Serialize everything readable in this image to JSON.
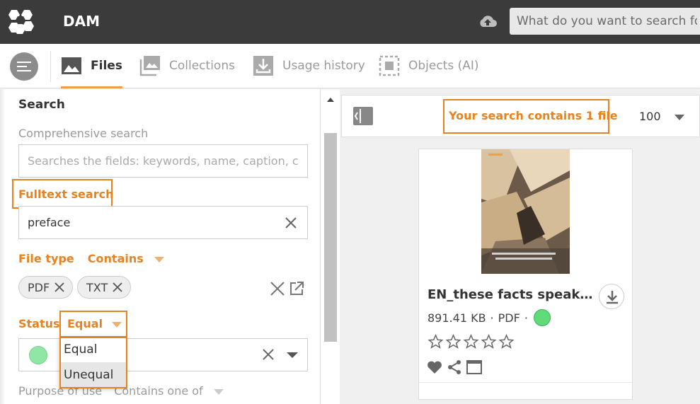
{
  "app": {
    "title": "DAM"
  },
  "header": {
    "search_placeholder": "What do you want to search for?"
  },
  "tabs": [
    {
      "label": "Files",
      "icon": "image-icon",
      "active": true
    },
    {
      "label": "Collections",
      "icon": "collections-icon",
      "active": false
    },
    {
      "label": "Usage history",
      "icon": "download-tray-icon",
      "active": false
    },
    {
      "label": "Objects (AI)",
      "icon": "object-detect-icon",
      "active": false
    }
  ],
  "search_panel": {
    "title": "Search",
    "comprehensive": {
      "label": "Comprehensive search",
      "placeholder": "Searches the fields: keywords, name, caption, c..."
    },
    "fulltext": {
      "label": "Fulltext search",
      "value": "preface"
    },
    "file_type": {
      "label": "File type",
      "operator": "Contains",
      "chips": [
        "PDF",
        "TXT"
      ]
    },
    "status": {
      "label": "Status",
      "operator": "Equal",
      "dropdown_options": [
        "Equal",
        "Unequal"
      ],
      "selected_color": "#8fe6a5"
    },
    "purpose": {
      "label": "Purpose of use",
      "operator": "Contains one of"
    }
  },
  "results": {
    "count_text": "Your search contains 1 file",
    "per_page": "100",
    "items": [
      {
        "title": "EN_these facts speak in f...",
        "size": "891.41 KB",
        "type": "PDF",
        "separator": "·",
        "status_color": "#5fdc78",
        "rating": 0,
        "rating_max": 5
      }
    ]
  },
  "colors": {
    "accent": "#e8821f",
    "topbar": "#3b3b3b"
  }
}
